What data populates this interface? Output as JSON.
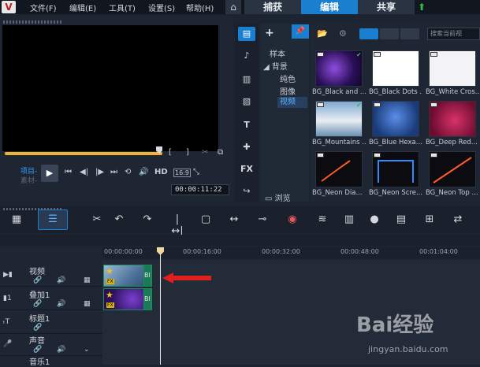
{
  "menu": {
    "logo": "V",
    "file": "文件(F)",
    "edit": "编辑(E)",
    "tools": "工具(T)",
    "settings": "设置(S)",
    "help": "帮助(H)"
  },
  "tabs": {
    "home_icon": "home-icon",
    "capture": "捕获",
    "edit": "编辑",
    "share": "共享"
  },
  "preview": {
    "mode_project": "项目-",
    "mode_clip": "素材-",
    "hd": "HD",
    "ratio": "16:9",
    "timecode": "00:00:11:22"
  },
  "library": {
    "tree": {
      "sample": "样本",
      "background": "背景",
      "solid": "纯色",
      "image": "图像",
      "video": "视频"
    },
    "browse": "浏览",
    "search_placeholder": "搜索当前视",
    "items": [
      {
        "label": "BG_Black and ...",
        "checked": true,
        "color": "#3a1a6e"
      },
      {
        "label": "BG_Black Dots ...",
        "checked": false,
        "color": "#ffffff"
      },
      {
        "label": "BG_White Cros...",
        "checked": false,
        "color": "#f3f3f5"
      },
      {
        "label": "BG_Mountains ...",
        "checked": true,
        "color": "#6f93b8"
      },
      {
        "label": "BG_Blue Hexa...",
        "checked": false,
        "color": "#2b64b8"
      },
      {
        "label": "BG_Deep Red...",
        "checked": false,
        "color": "#a8204a"
      },
      {
        "label": "BG_Neon Dia...",
        "checked": false,
        "color": "#0c0c10"
      },
      {
        "label": "BG_Neon Scre...",
        "checked": false,
        "color": "#0c0c10"
      },
      {
        "label": "BG_Neon Top ...",
        "checked": false,
        "color": "#0c0c10"
      }
    ]
  },
  "timeline": {
    "ruler": [
      "00:00:00:00",
      "00:00:16:00",
      "00:00:32:00",
      "00:00:48:00",
      "00:01:04:00"
    ],
    "tracks": {
      "video": "视频",
      "overlay": "叠加1",
      "title": "标题1",
      "voice": "声音",
      "music": "音乐1"
    },
    "clip_tail": "Bl"
  },
  "watermark": {
    "main": "Bai经验",
    "sub": "jingyan.baidu.com"
  }
}
